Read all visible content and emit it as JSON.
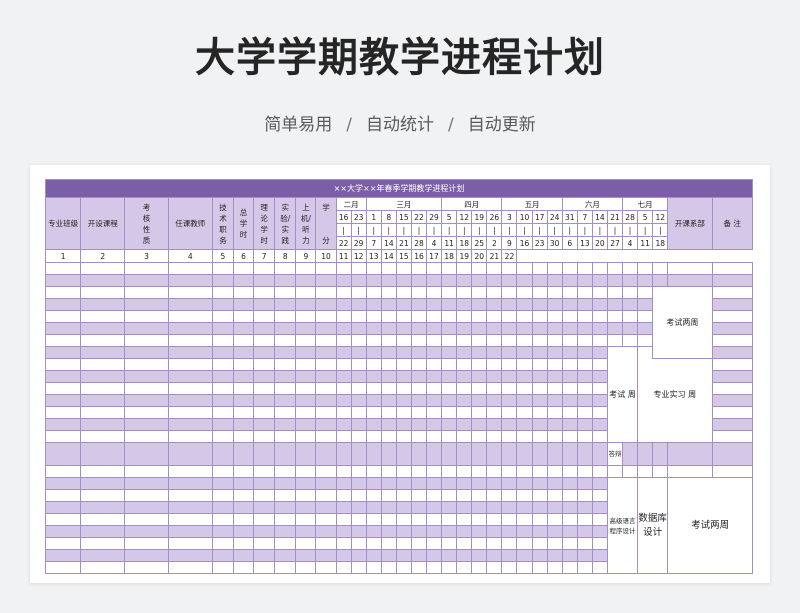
{
  "header": {
    "title": "大学学期教学进程计划",
    "tags": [
      "简单易用",
      "自动统计",
      "自动更新"
    ],
    "separator": "/"
  },
  "sheet": {
    "banner": "××大学××年春季学期教学进程计划",
    "columns": {
      "major": "专业班级",
      "course": "开设课程",
      "assess": "考核性质",
      "teacher": "任课教师",
      "title": "技术职务",
      "total_hours": "总学时",
      "theory_hours": "理论学时",
      "lab_hours": "实验/实践",
      "computer_hours": "上机/听力",
      "credits_top": "学",
      "credits_bottom": "分",
      "dept": "开课系部",
      "remarks": "备 注"
    },
    "months": [
      "二月",
      "三月",
      "四月",
      "五月",
      "六月",
      "七月"
    ],
    "week_start": [
      "16",
      "23",
      "1",
      "8",
      "15",
      "22",
      "29",
      "5",
      "12",
      "19",
      "26",
      "3",
      "10",
      "17",
      "24",
      "31",
      "7",
      "14",
      "21",
      "28",
      "5",
      "12"
    ],
    "dash": "|",
    "week_end": [
      "22",
      "29",
      "7",
      "14",
      "21",
      "28",
      "4",
      "11",
      "18",
      "25",
      "2",
      "9",
      "16",
      "23",
      "30",
      "6",
      "13",
      "20",
      "27",
      "4",
      "11",
      "18"
    ],
    "week_num": [
      "1",
      "2",
      "3",
      "4",
      "5",
      "6",
      "7",
      "8",
      "9",
      "10",
      "11",
      "12",
      "13",
      "14",
      "15",
      "16",
      "17",
      "18",
      "19",
      "20",
      "21",
      "22"
    ],
    "notes": {
      "exam_two_weeks_a": "考试两周",
      "exam_week": "考试 周",
      "internship": "专业实习 周",
      "defense": "答辩",
      "advanced_lang": "高级语言程序设计",
      "database": "数据库设计",
      "exam_two_weeks_b": "考试两周"
    }
  },
  "colors": {
    "banner": "#7b5ea7",
    "band": "#d5c7e7",
    "border": "#a48fc4",
    "page": "#f1f2f4"
  }
}
